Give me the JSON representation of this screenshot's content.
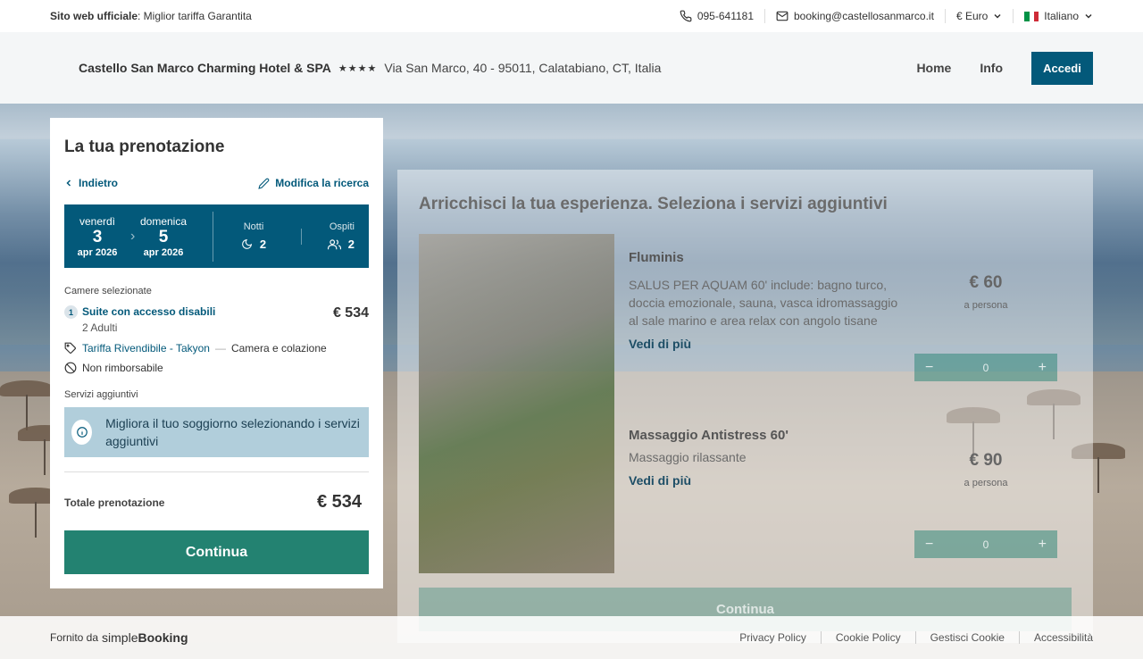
{
  "topbar": {
    "official_bold": "Sito web ufficiale",
    "official_text": ": Miglior tariffa Garantita",
    "phone": "095-641181",
    "email": "booking@castellosanmarco.it",
    "currency": "€ Euro",
    "language": "Italiano"
  },
  "header": {
    "hotel_name": "Castello San Marco Charming Hotel & SPA",
    "stars": "★★★★",
    "address": "Via San Marco, 40 - 95011, Calatabiano, CT, Italia",
    "nav": {
      "home": "Home",
      "info": "Info",
      "login": "Accedi"
    }
  },
  "booking": {
    "title": "La tua prenotazione",
    "back": "Indietro",
    "edit": "Modifica la ricerca",
    "checkin": {
      "weekday": "venerdì",
      "day": "3",
      "month": "apr 2026"
    },
    "checkout": {
      "weekday": "domenica",
      "day": "5",
      "month": "apr 2026"
    },
    "nights_label": "Notti",
    "nights": "2",
    "guests_label": "Ospiti",
    "guests": "2",
    "rooms_title": "Camere selezionate",
    "room": {
      "index": "1",
      "name": "Suite con accesso disabili",
      "adults": "2 Adulti",
      "price": "€ 534",
      "rate_name": "Tariffa Rivendibile - Takyon",
      "rate_dash": "—",
      "board": "Camera e colazione",
      "policy": "Non rimborsabile"
    },
    "services_title": "Servizi aggiuntivi",
    "services_info": "Migliora il tuo soggiorno selezionando i servizi aggiuntivi",
    "total_label": "Totale prenotazione",
    "total_value": "€ 534",
    "continue": "Continua"
  },
  "services": {
    "title": "Arricchisci la tua esperienza. Seleziona i servizi aggiuntivi",
    "items": [
      {
        "name": "Fluminis",
        "description": "SALUS PER AQUAM 60' include: bagno turco, doccia emozionale, sauna, vasca idromassaggio al sale marino e area relax con angolo tisane",
        "more": "Vedi di più",
        "price": "€ 60",
        "unit": "a persona",
        "qty": "0"
      },
      {
        "name": "Massaggio Antistress 60'",
        "description": "Massaggio rilassante",
        "more": "Vedi di più",
        "price": "€ 90",
        "unit": "a persona",
        "qty": "0"
      }
    ],
    "continue": "Continua"
  },
  "footer": {
    "provided_by": "Fornito da",
    "brand_light": "simple",
    "brand_bold": "Booking",
    "links": [
      "Privacy Policy",
      "Cookie Policy",
      "Gestisci Cookie",
      "Accessibilità"
    ]
  },
  "colors": {
    "primary": "#03597a",
    "accent": "#238271",
    "info_bg": "#b1cedb"
  }
}
